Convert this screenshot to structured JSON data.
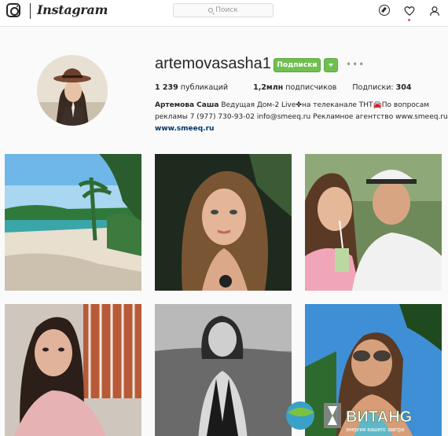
{
  "header": {
    "brand": "Instagram",
    "search_placeholder": "Поиск",
    "icons": [
      "instagram-logo-icon",
      "compass-icon",
      "heart-icon",
      "user-icon"
    ]
  },
  "profile": {
    "username": "artemovasasha1",
    "follow_label": "Подписки",
    "stats": [
      {
        "value": "1 239",
        "label": " публикаций"
      },
      {
        "value": "1,2млн",
        "label": " подписчиков"
      },
      {
        "label": "Подписки: ",
        "value": "304"
      }
    ],
    "bio": {
      "name": "Артемова Саша",
      "line1": " Ведущая Дом-2 Live✤на телеканале ТНТ🚘По вопросам",
      "line2_a": "рекламы ",
      "line2_phone": "7 (977) 730-93-02",
      "line2_b": " info@smeeq.ru",
      "line2_c": " Рекламное агентство ",
      "line2_site": "www.smeeq.ru",
      "link": "www.smeeq.ru"
    }
  },
  "posts": [
    {
      "subject": "beach with palm trees"
    },
    {
      "subject": "selfie of woman with long hair"
    },
    {
      "subject": "couple with straws"
    },
    {
      "subject": "selfie in pink blazer"
    },
    {
      "subject": "black and white swimsuit photo"
    },
    {
      "subject": "woman in sunglasses"
    }
  ],
  "watermark": {
    "brand": "ВИТАНG",
    "tagline": "энергия вашего завтра"
  },
  "colors": {
    "follow": "#70c050",
    "link": "#003569",
    "notification": "#ed4956"
  }
}
